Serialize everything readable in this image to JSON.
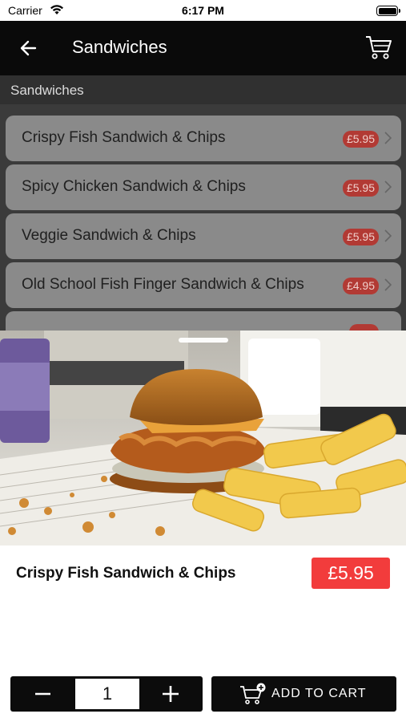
{
  "status_bar": {
    "carrier": "Carrier",
    "time": "6:17 PM"
  },
  "nav": {
    "title": "Sandwiches",
    "back_icon": "arrow-left-icon",
    "cart_icon": "cart-icon"
  },
  "list": {
    "section": "Sandwiches",
    "items": [
      {
        "name": "Crispy Fish Sandwich & Chips",
        "price": "£5.95"
      },
      {
        "name": "Spicy Chicken Sandwich & Chips",
        "price": "£5.95"
      },
      {
        "name": "Veggie Sandwich & Chips",
        "price": "£5.95"
      },
      {
        "name": "Old School Fish Finger Sandwich & Chips",
        "price": "£4.95"
      }
    ]
  },
  "detail": {
    "title": "Crispy Fish Sandwich & Chips",
    "price": "£5.95",
    "quantity": "1",
    "add_to_cart_label": "ADD TO CART"
  },
  "colors": {
    "nav_bg": "#0a0a0a",
    "price_red": "#f23c3c",
    "button_bg": "#0c0c0c"
  }
}
